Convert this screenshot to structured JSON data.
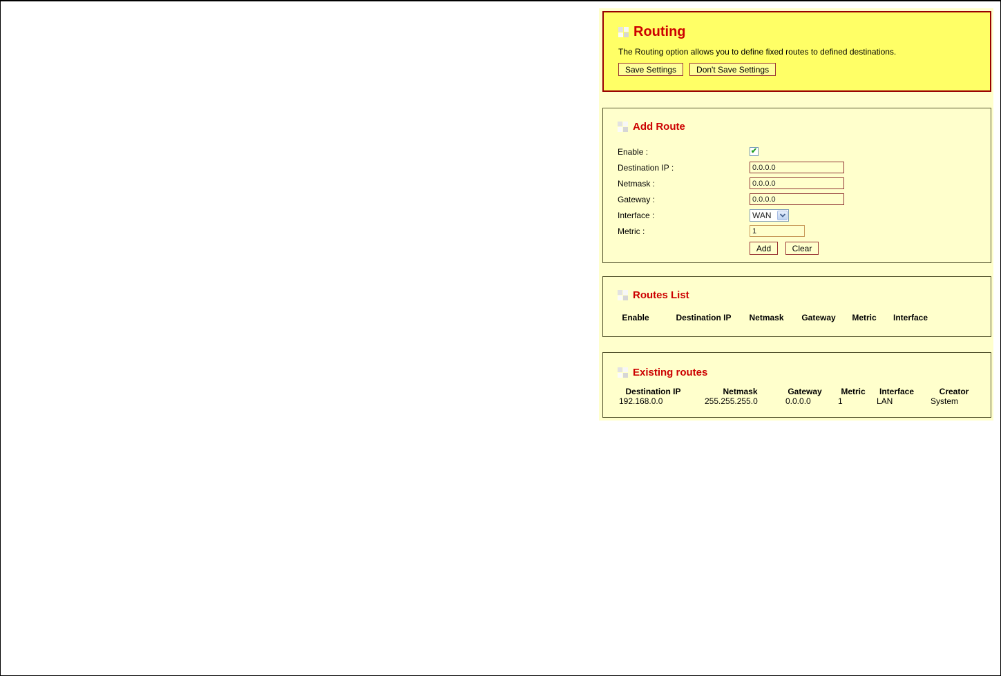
{
  "colors": {
    "page_background": "#ffffff",
    "column_background": "#ffffcc",
    "highlight_panel_background": "#ffff66",
    "highlight_panel_border": "#990000",
    "panel_border": "#55552e",
    "title_red": "#cc0000",
    "input_border": "#8f3434",
    "button_border": "#993333",
    "checkbox_check_green": "#1e9e1e"
  },
  "routing": {
    "title": "Routing",
    "description": "The Routing option allows you to define fixed routes to defined destinations.",
    "save_button": "Save Settings",
    "dont_save_button": "Don't Save Settings"
  },
  "add_route": {
    "title": "Add Route",
    "enable_label": "Enable :",
    "check_glyph": "✔",
    "fields": [
      {
        "label": "Destination IP :",
        "value": "0.0.0.0"
      },
      {
        "label": "Netmask :",
        "value": "0.0.0.0"
      },
      {
        "label": "Gateway :",
        "value": "0.0.0.0"
      }
    ],
    "interface_label": "Interface :",
    "interface_value": "WAN",
    "metric_label": "Metric :",
    "metric_value": "1",
    "add_button": "Add",
    "clear_button": "Clear"
  },
  "routes_list": {
    "title": "Routes List",
    "headers": [
      "Enable",
      "Destination IP",
      "Netmask",
      "Gateway",
      "Metric",
      "Interface"
    ]
  },
  "existing_routes": {
    "title": "Existing routes",
    "headers": [
      "Destination IP",
      "Netmask",
      "Gateway",
      "Metric",
      "Interface",
      "Creator"
    ],
    "rows": [
      [
        "192.168.0.0",
        "255.255.255.0",
        "0.0.0.0",
        "1",
        "LAN",
        "System"
      ]
    ]
  }
}
